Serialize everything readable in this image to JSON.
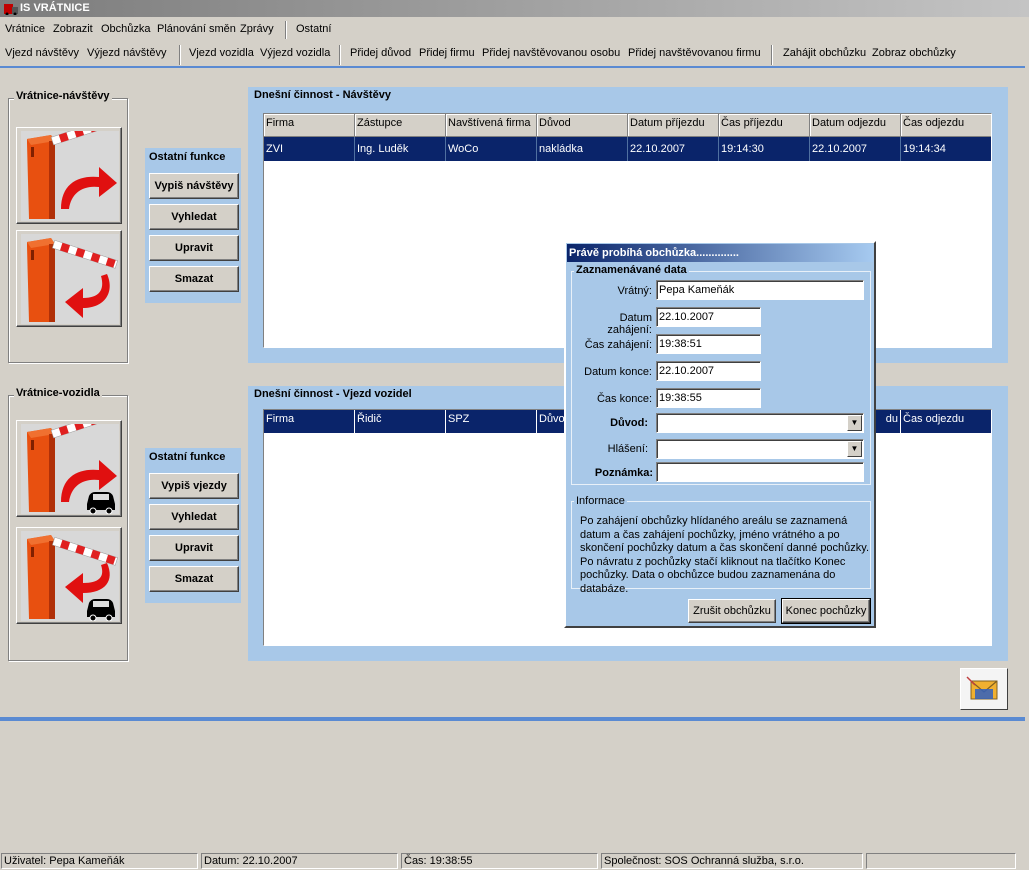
{
  "app": {
    "title": "IS VRÁTNICE"
  },
  "menu": [
    "Vrátnice",
    "Zobrazit",
    "Obchůzka",
    "Plánování směn",
    "Zprávy",
    "Ostatní"
  ],
  "toolbar": [
    "Vjezd návštěvy",
    "Výjezd návštěvy",
    "Vjezd vozidla",
    "Výjezd vozidla",
    "Přidej důvod",
    "Přidej firmu",
    "Přidej navštěvovanou osobu",
    "Přidej navštěvovanou firmu",
    "Zahájit obchůzku",
    "Zobraz obchůzky"
  ],
  "visitors": {
    "group_title": "Vrátnice-návštěvy",
    "functions": {
      "title": "Ostatní funkce",
      "buttons": [
        "Vypiš návštěvy",
        "Vyhledat",
        "Upravit",
        "Smazat"
      ]
    },
    "activity": {
      "title": "Dnešní činnost - Návštěvy",
      "columns": [
        "Firma",
        "Zástupce",
        "Navštívená firma",
        "Důvod",
        "Datum příjezdu",
        "Čas příjezdu",
        "Datum odjezdu",
        "Čas odjezdu"
      ],
      "rows": [
        [
          "ZVI",
          "Ing. Luděk",
          "WoCo",
          "nakládka",
          "22.10.2007",
          "19:14:30",
          "22.10.2007",
          "19:14:34"
        ]
      ]
    }
  },
  "vehicles": {
    "group_title": "Vrátnice-vozidla",
    "functions": {
      "title": "Ostatní funkce",
      "buttons": [
        "Vypiš vjezdy",
        "Vyhledat",
        "Upravit",
        "Smazat"
      ]
    },
    "activity": {
      "title": "Dnešní činnost - Vjezd vozidel",
      "columns": [
        "Firma",
        "Řidič",
        "SPZ",
        "Důvo",
        "du",
        "Čas odjezdu"
      ]
    }
  },
  "dialog": {
    "title": "Právě probíhá obchůzka..............",
    "section_title": "Zaznamenávané data",
    "fields": {
      "guard_label": "Vrátný:",
      "guard_value": "Pepa Kameňák",
      "start_date_label": "Datum zahájení:",
      "start_date_value": "22.10.2007",
      "start_time_label": "Čas zahájení:",
      "start_time_value": "19:38:51",
      "end_date_label": "Datum konce:",
      "end_date_value": "22.10.2007",
      "end_time_label": "Čas konce:",
      "end_time_value": "19:38:55",
      "reason_label": "Důvod:",
      "reason_value": "",
      "report_label": "Hlášení:",
      "report_value": "",
      "note_label": "Poznámka:",
      "note_value": ""
    },
    "info_title": "Informace",
    "info_text": "Po zahájení obchůzky hlídaného areálu se zaznamená datum a čas zahájení pochůzky, jméno vrátného a po skončení pochůzky datum a čas skončení danné pochůzky. Po návratu z pochůzky stačí kliknout na tlačítko Konec pochůzky. Data o obchůzce budou zaznamenána do databáze.",
    "cancel_button": "Zrušit obchůzku",
    "end_button": "Konec pochůzky"
  },
  "status": {
    "user": "Uživatel: Pepa Kameňák",
    "date": "Datum: 22.10.2007",
    "time": "Čas: 19:38:55",
    "company": "Společnost: SOS Ochranná služba, s.r.o."
  },
  "colors": {
    "panel": "#a8c8e8",
    "selection": "#0a246a",
    "accent_line": "#5a8ad2",
    "barrier": "#e04010",
    "arrow": "#e01010"
  }
}
